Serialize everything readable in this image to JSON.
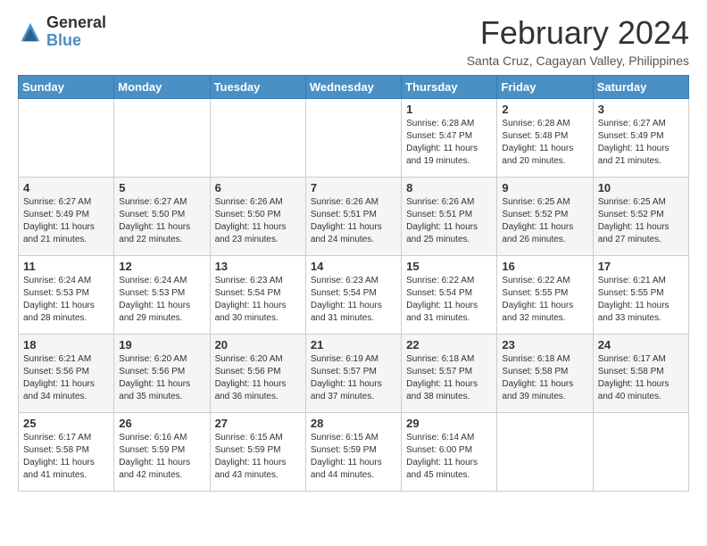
{
  "logo": {
    "general": "General",
    "blue": "Blue"
  },
  "header": {
    "month_year": "February 2024",
    "location": "Santa Cruz, Cagayan Valley, Philippines"
  },
  "days_of_week": [
    "Sunday",
    "Monday",
    "Tuesday",
    "Wednesday",
    "Thursday",
    "Friday",
    "Saturday"
  ],
  "weeks": [
    [
      {
        "day": "",
        "info": ""
      },
      {
        "day": "",
        "info": ""
      },
      {
        "day": "",
        "info": ""
      },
      {
        "day": "",
        "info": ""
      },
      {
        "day": "1",
        "info": "Sunrise: 6:28 AM\nSunset: 5:47 PM\nDaylight: 11 hours\nand 19 minutes."
      },
      {
        "day": "2",
        "info": "Sunrise: 6:28 AM\nSunset: 5:48 PM\nDaylight: 11 hours\nand 20 minutes."
      },
      {
        "day": "3",
        "info": "Sunrise: 6:27 AM\nSunset: 5:49 PM\nDaylight: 11 hours\nand 21 minutes."
      }
    ],
    [
      {
        "day": "4",
        "info": "Sunrise: 6:27 AM\nSunset: 5:49 PM\nDaylight: 11 hours\nand 21 minutes."
      },
      {
        "day": "5",
        "info": "Sunrise: 6:27 AM\nSunset: 5:50 PM\nDaylight: 11 hours\nand 22 minutes."
      },
      {
        "day": "6",
        "info": "Sunrise: 6:26 AM\nSunset: 5:50 PM\nDaylight: 11 hours\nand 23 minutes."
      },
      {
        "day": "7",
        "info": "Sunrise: 6:26 AM\nSunset: 5:51 PM\nDaylight: 11 hours\nand 24 minutes."
      },
      {
        "day": "8",
        "info": "Sunrise: 6:26 AM\nSunset: 5:51 PM\nDaylight: 11 hours\nand 25 minutes."
      },
      {
        "day": "9",
        "info": "Sunrise: 6:25 AM\nSunset: 5:52 PM\nDaylight: 11 hours\nand 26 minutes."
      },
      {
        "day": "10",
        "info": "Sunrise: 6:25 AM\nSunset: 5:52 PM\nDaylight: 11 hours\nand 27 minutes."
      }
    ],
    [
      {
        "day": "11",
        "info": "Sunrise: 6:24 AM\nSunset: 5:53 PM\nDaylight: 11 hours\nand 28 minutes."
      },
      {
        "day": "12",
        "info": "Sunrise: 6:24 AM\nSunset: 5:53 PM\nDaylight: 11 hours\nand 29 minutes."
      },
      {
        "day": "13",
        "info": "Sunrise: 6:23 AM\nSunset: 5:54 PM\nDaylight: 11 hours\nand 30 minutes."
      },
      {
        "day": "14",
        "info": "Sunrise: 6:23 AM\nSunset: 5:54 PM\nDaylight: 11 hours\nand 31 minutes."
      },
      {
        "day": "15",
        "info": "Sunrise: 6:22 AM\nSunset: 5:54 PM\nDaylight: 11 hours\nand 31 minutes."
      },
      {
        "day": "16",
        "info": "Sunrise: 6:22 AM\nSunset: 5:55 PM\nDaylight: 11 hours\nand 32 minutes."
      },
      {
        "day": "17",
        "info": "Sunrise: 6:21 AM\nSunset: 5:55 PM\nDaylight: 11 hours\nand 33 minutes."
      }
    ],
    [
      {
        "day": "18",
        "info": "Sunrise: 6:21 AM\nSunset: 5:56 PM\nDaylight: 11 hours\nand 34 minutes."
      },
      {
        "day": "19",
        "info": "Sunrise: 6:20 AM\nSunset: 5:56 PM\nDaylight: 11 hours\nand 35 minutes."
      },
      {
        "day": "20",
        "info": "Sunrise: 6:20 AM\nSunset: 5:56 PM\nDaylight: 11 hours\nand 36 minutes."
      },
      {
        "day": "21",
        "info": "Sunrise: 6:19 AM\nSunset: 5:57 PM\nDaylight: 11 hours\nand 37 minutes."
      },
      {
        "day": "22",
        "info": "Sunrise: 6:18 AM\nSunset: 5:57 PM\nDaylight: 11 hours\nand 38 minutes."
      },
      {
        "day": "23",
        "info": "Sunrise: 6:18 AM\nSunset: 5:58 PM\nDaylight: 11 hours\nand 39 minutes."
      },
      {
        "day": "24",
        "info": "Sunrise: 6:17 AM\nSunset: 5:58 PM\nDaylight: 11 hours\nand 40 minutes."
      }
    ],
    [
      {
        "day": "25",
        "info": "Sunrise: 6:17 AM\nSunset: 5:58 PM\nDaylight: 11 hours\nand 41 minutes."
      },
      {
        "day": "26",
        "info": "Sunrise: 6:16 AM\nSunset: 5:59 PM\nDaylight: 11 hours\nand 42 minutes."
      },
      {
        "day": "27",
        "info": "Sunrise: 6:15 AM\nSunset: 5:59 PM\nDaylight: 11 hours\nand 43 minutes."
      },
      {
        "day": "28",
        "info": "Sunrise: 6:15 AM\nSunset: 5:59 PM\nDaylight: 11 hours\nand 44 minutes."
      },
      {
        "day": "29",
        "info": "Sunrise: 6:14 AM\nSunset: 6:00 PM\nDaylight: 11 hours\nand 45 minutes."
      },
      {
        "day": "",
        "info": ""
      },
      {
        "day": "",
        "info": ""
      }
    ]
  ]
}
